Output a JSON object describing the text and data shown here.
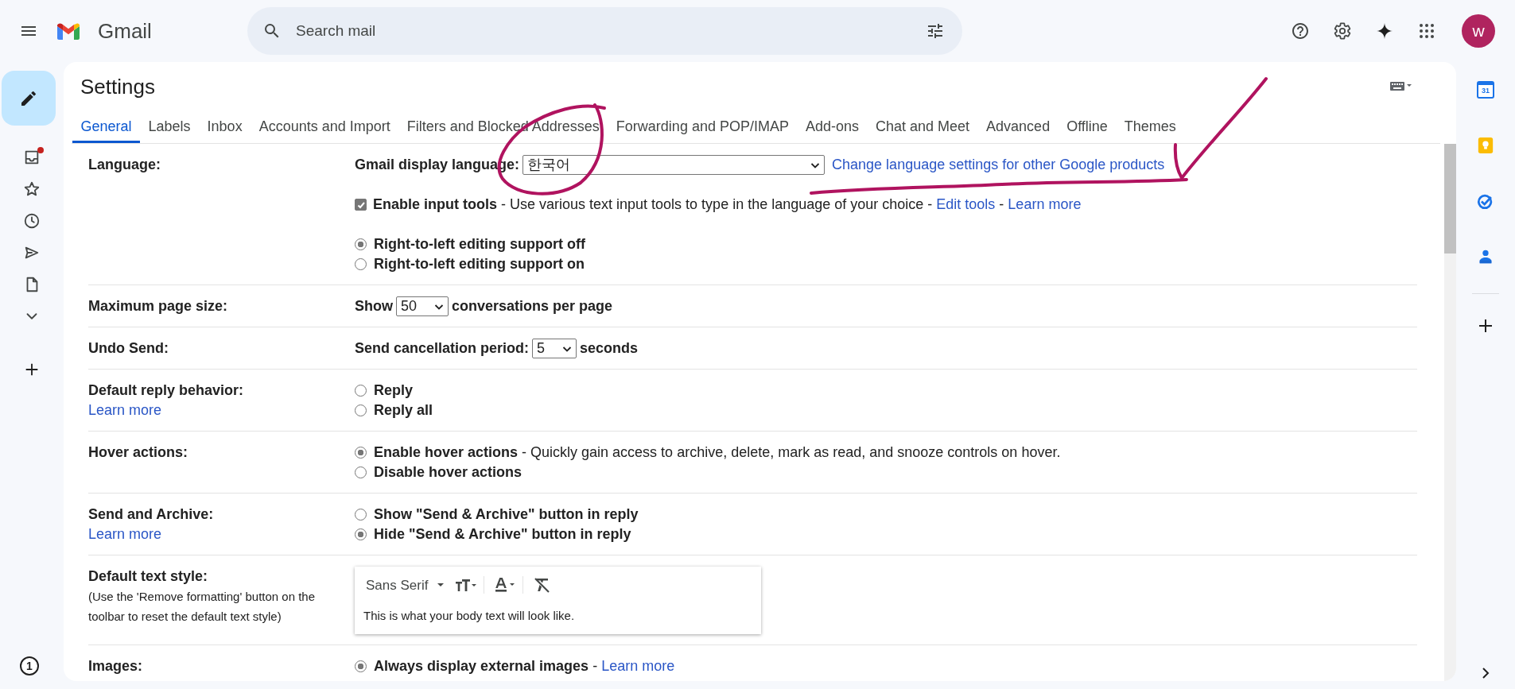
{
  "header": {
    "app_name": "Gmail",
    "search": {
      "placeholder": "Search mail"
    },
    "avatar": {
      "initial": "w"
    }
  },
  "left_rail": {
    "items": [
      {
        "kind": "inbox",
        "unread_dot": true
      },
      {
        "kind": "starred",
        "unread_dot": false
      },
      {
        "kind": "snoozed",
        "unread_dot": false
      },
      {
        "kind": "sent",
        "unread_dot": false
      },
      {
        "kind": "drafts",
        "unread_dot": false
      },
      {
        "kind": "more",
        "unread_dot": false
      }
    ],
    "status_badge": "1"
  },
  "settings": {
    "title": "Settings",
    "tabs": [
      {
        "label": "General",
        "selected": true
      },
      {
        "label": "Labels",
        "selected": false
      },
      {
        "label": "Inbox",
        "selected": false
      },
      {
        "label": "Accounts and Import",
        "selected": false
      },
      {
        "label": "Filters and Blocked Addresses",
        "selected": false
      },
      {
        "label": "Forwarding and POP/IMAP",
        "selected": false
      },
      {
        "label": "Add-ons",
        "selected": false
      },
      {
        "label": "Chat and Meet",
        "selected": false
      },
      {
        "label": "Advanced",
        "selected": false
      },
      {
        "label": "Offline",
        "selected": false
      },
      {
        "label": "Themes",
        "selected": false
      }
    ]
  },
  "rows": [
    {
      "label": "Language:",
      "lines": [
        {
          "kind": "language_select",
          "label": "Gmail display language:",
          "value": "한국어",
          "link": "Change language settings for other Google products"
        },
        {
          "kind": "checkbox",
          "checked": true,
          "label": "Enable input tools",
          "parts": [
            {
              "text": "- Use various text input tools to type in the language of your choice -"
            },
            {
              "link": "Edit tools"
            },
            {
              "text": "-"
            },
            {
              "link": "Learn more"
            }
          ]
        },
        {
          "kind": "radio",
          "selected": true,
          "label": "Right-to-left editing support off"
        },
        {
          "kind": "radio",
          "selected": false,
          "label": "Right-to-left editing support on"
        }
      ]
    },
    {
      "label": "Maximum page size:",
      "lines": [
        {
          "kind": "select",
          "label": "Show",
          "value": "50",
          "after": "conversations per page"
        }
      ]
    },
    {
      "label": "Undo Send:",
      "lines": [
        {
          "kind": "select",
          "label": "Send cancellation period:",
          "value": "5",
          "after": "seconds"
        }
      ]
    },
    {
      "label": "Default reply behavior:",
      "link": "Learn more",
      "lines": [
        {
          "kind": "radio",
          "selected": false,
          "label": "Reply"
        },
        {
          "kind": "radio",
          "selected": false,
          "label": "Reply all"
        }
      ]
    },
    {
      "label": "Hover actions:",
      "lines": [
        {
          "kind": "radio",
          "selected": true,
          "label": "Enable hover actions",
          "parts": [
            {
              "text": "- Quickly gain access to archive, delete, mark as read, and snooze controls on hover."
            }
          ]
        },
        {
          "kind": "radio",
          "selected": false,
          "label": "Disable hover actions"
        }
      ]
    },
    {
      "label": "Send and Archive:",
      "link": "Learn more",
      "lines": [
        {
          "kind": "radio",
          "selected": false,
          "label": "Show \"Send & Archive\" button in reply"
        },
        {
          "kind": "radio",
          "selected": true,
          "label": "Hide \"Send & Archive\" button in reply"
        }
      ]
    },
    {
      "label": "Default text style:",
      "note": "(Use the 'Remove formatting' button on the toolbar to reset the default text style)",
      "lines": [
        {
          "kind": "editor",
          "font": "Sans Serif",
          "sample": "This is what your body text will look like."
        }
      ]
    },
    {
      "label": "Images:",
      "lines": [
        {
          "kind": "radio",
          "selected": true,
          "label": "Always display external images",
          "parts": [
            {
              "text": "-"
            },
            {
              "link": "Learn more"
            }
          ]
        }
      ]
    }
  ],
  "side_panel": {
    "items": [
      {
        "kind": "calendar",
        "text": "31"
      },
      {
        "kind": "keep"
      },
      {
        "kind": "tasks"
      },
      {
        "kind": "contacts"
      }
    ]
  },
  "annotations": [
    {
      "kind": "circle"
    },
    {
      "kind": "underline"
    },
    {
      "kind": "arrow"
    }
  ]
}
